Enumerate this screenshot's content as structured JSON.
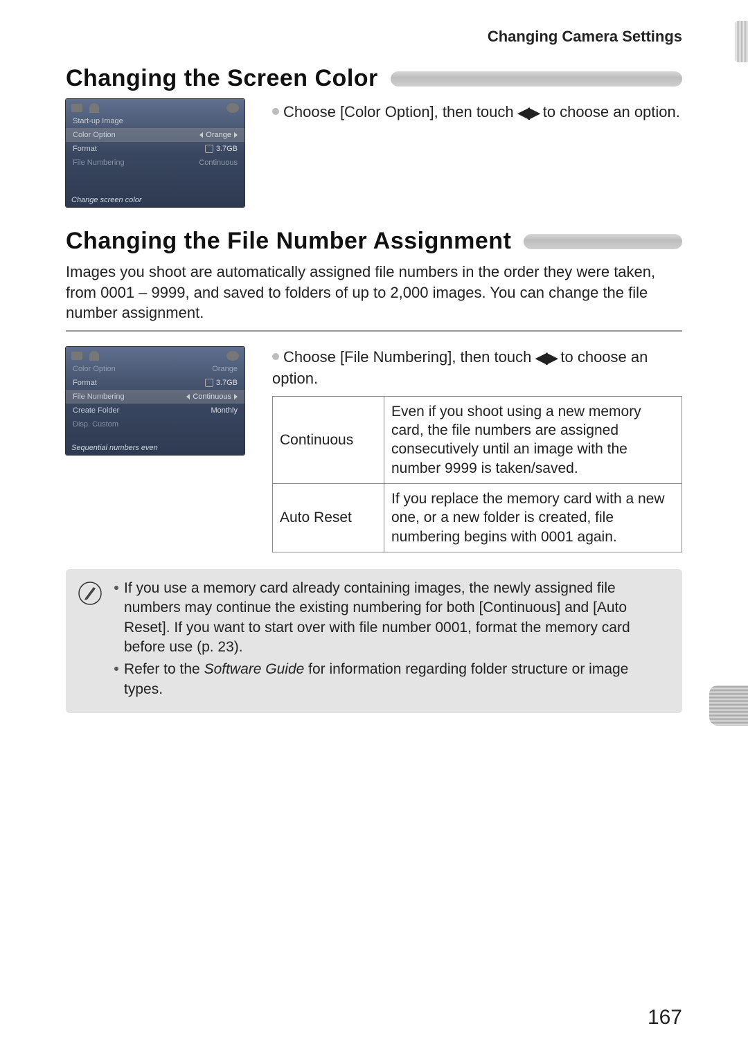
{
  "header": "Changing Camera Settings",
  "section1": {
    "title": "Changing the Screen Color",
    "instruction_pre": "Choose [Color Option], then touch ",
    "instruction_post": " to choose an option.",
    "screen": {
      "rows": [
        {
          "label": "Start-up Image",
          "value": ""
        },
        {
          "label": "Color Option",
          "value": "Orange",
          "highlight": true,
          "arrows": true
        },
        {
          "label": "Format",
          "value": "3.7GB",
          "disk": true
        },
        {
          "label": "File Numbering",
          "value": "Continuous",
          "faded": true
        }
      ],
      "help": "Change screen color"
    }
  },
  "section2": {
    "title": "Changing the File Number Assignment",
    "intro": "Images you shoot are automatically assigned file numbers in the order they were taken, from 0001 – 9999, and saved to folders of up to 2,000 images. You can change the file number assignment.",
    "instruction_pre": "Choose [File Numbering], then touch ",
    "instruction_post": " to choose an option.",
    "screen": {
      "rows": [
        {
          "label": "Color Option",
          "value": "Orange",
          "faded": true
        },
        {
          "label": "Format",
          "value": "3.7GB",
          "disk": true
        },
        {
          "label": "File Numbering",
          "value": "Continuous",
          "highlight": true,
          "arrows": true
        },
        {
          "label": "Create Folder",
          "value": "Monthly"
        },
        {
          "label": "Disp. Custom",
          "value": "",
          "faded": true
        }
      ],
      "help": "Sequential numbers even"
    },
    "options": [
      {
        "name": "Continuous",
        "desc": "Even if you shoot using a new memory card, the file numbers are assigned consecutively until an image with the number 9999 is taken/saved."
      },
      {
        "name": "Auto Reset",
        "desc": "If you replace the memory card with a new one, or a new folder is created, file numbering begins with 0001 again."
      }
    ]
  },
  "note": {
    "items": [
      "If you use a memory card already containing images, the newly assigned file numbers may continue the existing numbering for both [Continuous] and [Auto Reset]. If you want to start over with file number 0001, format the memory card before use (p. 23).",
      "Refer to the Software Guide for information regarding folder structure or image types."
    ],
    "italic_phrase": "Software Guide"
  },
  "page_number": "167"
}
